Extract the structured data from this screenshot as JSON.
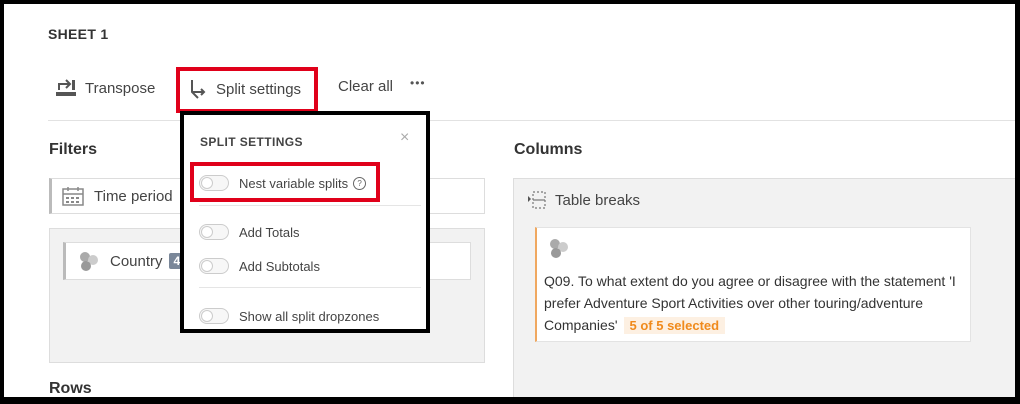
{
  "sheet": {
    "title": "SHEET 1"
  },
  "toolbar": {
    "transpose_label": "Transpose",
    "split_settings_label": "Split settings",
    "clear_all_label": "Clear all",
    "more_label": "•••"
  },
  "filters": {
    "title": "Filters",
    "time_period_label": "Time period",
    "country_label": "Country",
    "country_badge": "4"
  },
  "columns": {
    "title": "Columns",
    "table_breaks_label": "Table breaks",
    "card_text": "Q09. To what extent do you agree or disagree with the statement 'I prefer Adventure Sport Activities over other touring/adventure Companies'",
    "card_selected": "5 of 5 selected"
  },
  "rows": {
    "title": "Rows"
  },
  "split_settings": {
    "title": "SPLIT SETTINGS",
    "close_label": "×",
    "help_label": "?",
    "options": [
      {
        "label": "Nest variable splits",
        "on": false
      },
      {
        "label": "Add Totals",
        "on": false
      },
      {
        "label": "Add Subtotals",
        "on": false
      },
      {
        "label": "Show all split dropzones",
        "on": false
      }
    ]
  },
  "colors": {
    "highlight": "#e0001a",
    "accent": "#f08a1c",
    "badge": "#7a8799"
  }
}
